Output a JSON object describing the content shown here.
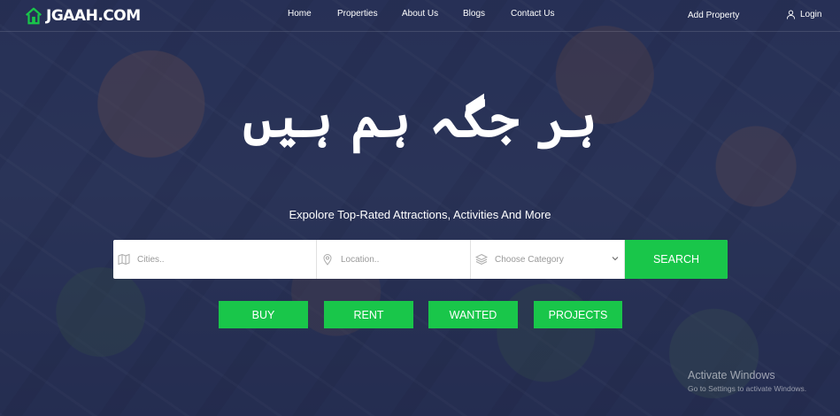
{
  "brand": {
    "name": "JGAAH.COM",
    "accent_color": "#19c64a"
  },
  "nav": {
    "items": [
      "Home",
      "Properties",
      "About Us",
      "Blogs",
      "Contact Us"
    ],
    "add_property": "Add Property",
    "login": "Login"
  },
  "hero": {
    "tagline_urdu": "ہر جگہ ہم ہیں",
    "subtitle": "Expolore Top-Rated Attractions, Activities And More"
  },
  "search": {
    "city_placeholder": "Cities..",
    "location_placeholder": "Location..",
    "category_value": "Choose Category",
    "button": "SEARCH"
  },
  "purposes": [
    "BUY",
    "RENT",
    "WANTED",
    "PROJECTS"
  ],
  "watermark": {
    "title": "Activate Windows",
    "subtitle": "Go to Settings to activate Windows."
  },
  "icons": {
    "logo": "house-icon",
    "login": "user-icon",
    "city": "map-icon",
    "location": "pin-icon",
    "category": "layers-icon",
    "category_caret": "chevron-down-icon"
  }
}
